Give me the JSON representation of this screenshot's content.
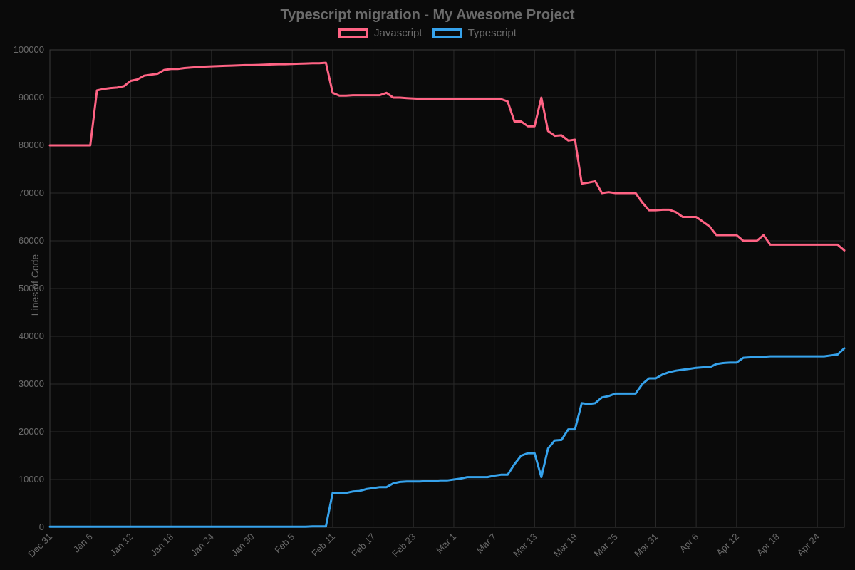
{
  "chart_data": {
    "type": "line",
    "title": "Typescript migration - My Awesome Project",
    "ylabel": "Lines of Code",
    "xlabel": "",
    "ylim": [
      0,
      100000
    ],
    "y_ticks": [
      0,
      10000,
      20000,
      30000,
      40000,
      50000,
      60000,
      70000,
      80000,
      90000,
      100000
    ],
    "x_ticks": [
      "Dec 31",
      "Jan 6",
      "Jan 12",
      "Jan 18",
      "Jan 24",
      "Jan 30",
      "Feb 5",
      "Feb 11",
      "Feb 17",
      "Feb 23",
      "Mar 1",
      "Mar 7",
      "Mar 13",
      "Mar 19",
      "Mar 25",
      "Mar 31",
      "Apr 6",
      "Apr 12",
      "Apr 18",
      "Apr 24"
    ],
    "x": [
      0,
      1,
      2,
      3,
      4,
      5,
      6,
      7,
      8,
      9,
      10,
      11,
      12,
      13,
      14,
      15,
      16,
      17,
      18,
      19,
      20,
      21,
      22,
      23,
      24,
      25,
      26,
      27,
      28,
      29,
      30,
      31,
      32,
      33,
      34,
      35,
      36,
      37,
      38,
      39,
      40,
      41,
      42,
      43,
      44,
      45,
      46,
      47,
      48,
      49,
      50,
      51,
      52,
      53,
      54,
      55,
      56,
      57,
      58,
      59,
      60,
      61,
      62,
      63,
      64,
      65,
      66,
      67,
      68,
      69,
      70,
      71,
      72,
      73,
      74,
      75,
      76,
      77,
      78,
      79,
      80,
      81,
      82,
      83,
      84,
      85,
      86,
      87,
      88,
      89,
      90,
      91,
      92,
      93,
      94,
      95,
      96,
      97,
      98,
      99,
      100,
      101,
      102,
      103,
      104,
      105,
      106,
      107,
      108,
      109,
      110,
      111,
      112,
      113,
      114,
      115,
      116,
      117,
      118
    ],
    "series": [
      {
        "name": "Javascript",
        "color": "#ff6384",
        "values": [
          80000,
          80000,
          80000,
          80000,
          80000,
          80000,
          80000,
          91500,
          91800,
          92000,
          92100,
          92400,
          93500,
          93800,
          94600,
          94800,
          95000,
          95800,
          96000,
          96000,
          96200,
          96300,
          96400,
          96500,
          96550,
          96600,
          96650,
          96700,
          96750,
          96800,
          96800,
          96850,
          96900,
          96950,
          97000,
          97000,
          97050,
          97100,
          97150,
          97200,
          97200,
          97300,
          91000,
          90400,
          90400,
          90500,
          90500,
          90500,
          90500,
          90500,
          91000,
          90000,
          90000,
          89900,
          89800,
          89750,
          89700,
          89700,
          89700,
          89700,
          89700,
          89700,
          89700,
          89700,
          89700,
          89700,
          89700,
          89700,
          89200,
          85000,
          85000,
          84000,
          84000,
          90000,
          83000,
          82000,
          82100,
          81000,
          81200,
          72000,
          72200,
          72500,
          70000,
          70200,
          70000,
          70000,
          70000,
          70000,
          68000,
          66400,
          66400,
          66500,
          66500,
          66000,
          65000,
          65000,
          65000,
          64000,
          63000,
          61200,
          61200,
          61200,
          61200,
          60000,
          60000,
          60000,
          61200,
          59200,
          59200,
          59200,
          59200,
          59200,
          59200,
          59200,
          59200,
          59200,
          59200,
          59200,
          58000
        ]
      },
      {
        "name": "Typescript",
        "color": "#36a2eb",
        "values": [
          100,
          100,
          100,
          100,
          100,
          100,
          100,
          100,
          100,
          100,
          100,
          100,
          100,
          100,
          100,
          100,
          100,
          100,
          100,
          100,
          100,
          100,
          100,
          100,
          100,
          100,
          100,
          100,
          100,
          100,
          100,
          100,
          100,
          100,
          100,
          100,
          100,
          100,
          100,
          200,
          200,
          200,
          7200,
          7200,
          7200,
          7500,
          7600,
          8000,
          8200,
          8400,
          8400,
          9200,
          9500,
          9600,
          9600,
          9600,
          9700,
          9700,
          9800,
          9800,
          10000,
          10200,
          10500,
          10500,
          10500,
          10500,
          10800,
          11000,
          11000,
          13200,
          15000,
          15500,
          15500,
          10500,
          16500,
          18200,
          18300,
          20500,
          20500,
          26000,
          25800,
          26000,
          27200,
          27500,
          28000,
          28000,
          28000,
          28000,
          30000,
          31200,
          31200,
          32000,
          32500,
          32800,
          33000,
          33200,
          33400,
          33500,
          33500,
          34200,
          34400,
          34500,
          34500,
          35500,
          35600,
          35700,
          35700,
          35800,
          35800,
          35800,
          35800,
          35800,
          35800,
          35800,
          35800,
          35800,
          36000,
          36200,
          37500
        ]
      }
    ],
    "legend": [
      "Javascript",
      "Typescript"
    ]
  }
}
